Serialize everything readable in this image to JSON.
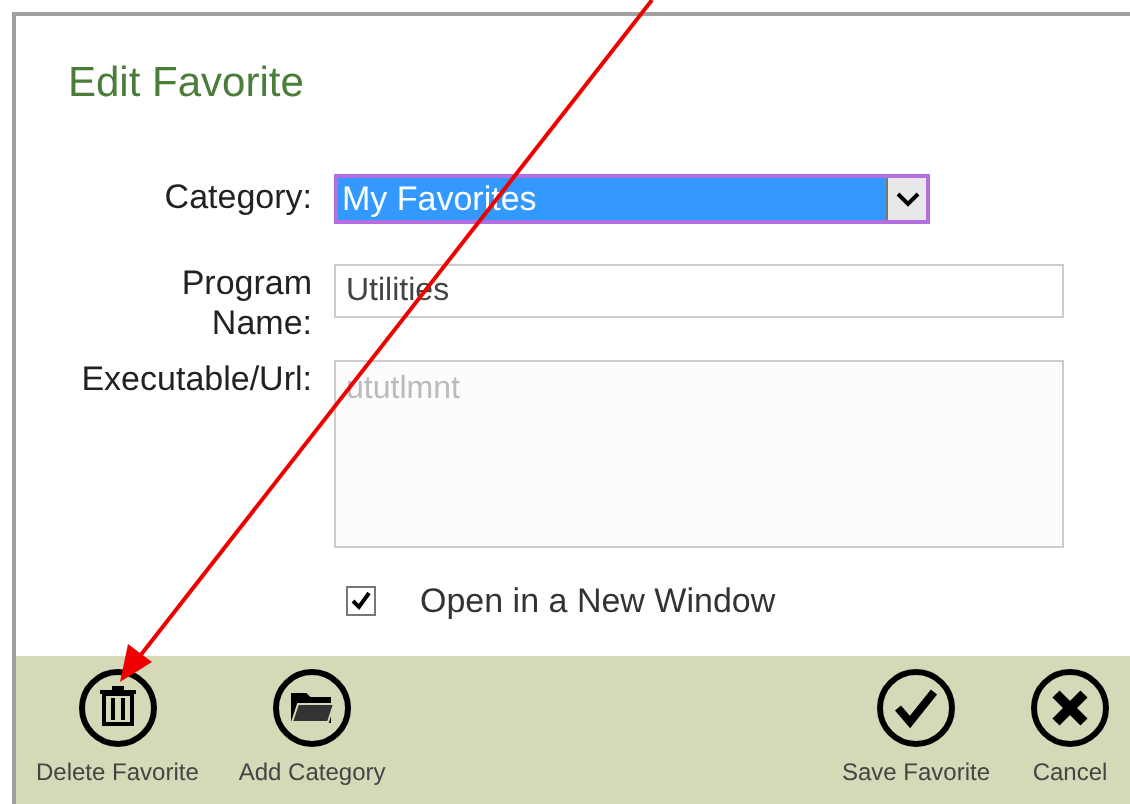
{
  "dialog": {
    "title": "Edit Favorite"
  },
  "form": {
    "category": {
      "label": "Category:",
      "value": "My Favorites"
    },
    "program_name": {
      "label": "Program Name:",
      "value": "Utilities"
    },
    "executable": {
      "label": "Executable/Url:",
      "placeholder": "ututlmnt"
    },
    "open_new_window": {
      "label": "Open in a New Window",
      "checked": true
    }
  },
  "toolbar": [
    {
      "kind": "trash",
      "label": "Delete Favorite"
    },
    {
      "kind": "folder",
      "label": "Add Category"
    },
    {
      "kind": "spacer"
    },
    {
      "kind": "check",
      "label": "Save Favorite"
    },
    {
      "kind": "close",
      "label": "Cancel"
    }
  ],
  "annotation": {
    "kind": "arrow"
  }
}
